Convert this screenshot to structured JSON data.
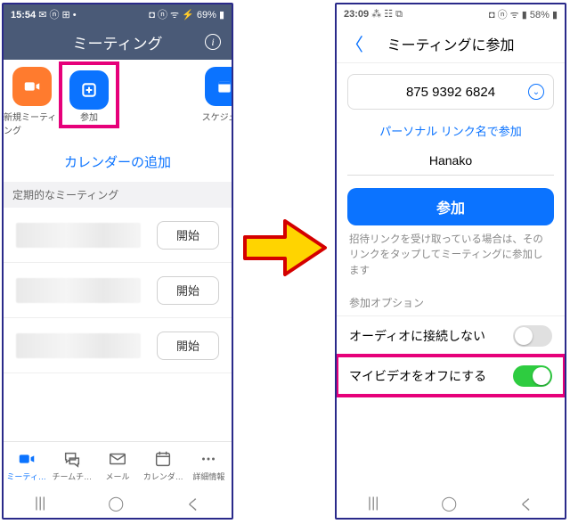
{
  "left": {
    "status": {
      "time": "15:54",
      "left_icons": "✉ ⓝ ⊞  •",
      "right": "◘ ⓝ ᯤ ⚡ 69% ▮"
    },
    "header": {
      "title": "ミーティング",
      "info": "i"
    },
    "actions": {
      "new": {
        "label": "新規ミーティング"
      },
      "join": {
        "label": "参加"
      },
      "sched": {
        "label": "スケジュ"
      }
    },
    "add_calendar": "カレンダーの追加",
    "section_header": "定期的なミーティング",
    "rows": [
      {
        "start": "開始"
      },
      {
        "start": "開始"
      },
      {
        "start": "開始"
      }
    ],
    "tabs": {
      "meeting": "ミーティ…",
      "team": "チームチ…",
      "mail": "メール",
      "calendar": "カレンダ…",
      "more": "詳細情報"
    },
    "sysnav": {
      "recents": "|||",
      "home": "◯",
      "back": "く"
    }
  },
  "right": {
    "status": {
      "time": "23:09",
      "left_icons": "⁂ ☷ ⧉",
      "right": "◘ ⓝ ᯤ ▮ 58% ▮"
    },
    "header": {
      "back": "〈",
      "title": "ミーティングに参加"
    },
    "meeting_id": "875 9392 6824",
    "dd": "⌄",
    "link_join": "パーソナル リンク名で参加",
    "name": "Hanako",
    "join_btn": "参加",
    "note": "招待リンクを受け取っている場合は、そのリンクをタップしてミーティングに参加します",
    "options_header": "参加オプション",
    "opts": {
      "audio": {
        "label": "オーディオに接続しない"
      },
      "video": {
        "label": "マイビデオをオフにする"
      }
    },
    "sysnav": {
      "recents": "|||",
      "home": "◯",
      "back": "く"
    }
  }
}
